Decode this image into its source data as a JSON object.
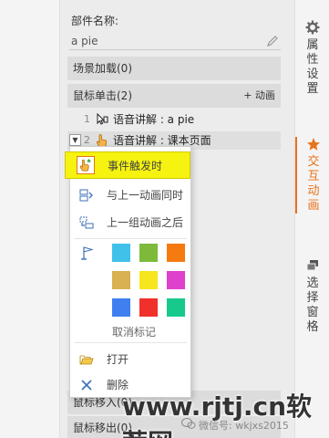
{
  "panel": {
    "name_label": "部件名称:",
    "name_value": "a pie",
    "sections": {
      "load": "场景加载(0)",
      "click": "鼠标单击(2)",
      "add_animation": "+ 动画",
      "hover": "鼠标移入(0)",
      "out": "鼠标移出(0)"
    },
    "rows": [
      {
        "num": "1",
        "text": "语音讲解 : a pie"
      },
      {
        "num": "2",
        "text": "语音讲解 : 课本页面"
      }
    ]
  },
  "right_bar": {
    "items": [
      {
        "label": "属性设置",
        "icon": "gear-icon"
      },
      {
        "label": "交互动画",
        "icon": "star-icon",
        "active": true
      },
      {
        "label": "选择窗格",
        "icon": "layers-icon"
      }
    ]
  },
  "menu": {
    "trigger": "事件触发时",
    "with_previous": "与上一动画同时",
    "after_previous": "上一组动画之后",
    "clear_mark": "取消标记",
    "open": "打开",
    "delete": "删除",
    "colors": [
      "#3fc1ea",
      "#7dba3a",
      "#f57a10",
      "#d9b052",
      "#f7e51e",
      "#df40cc",
      "#3f7ff0",
      "#f0302a",
      "#17c98a"
    ]
  },
  "watermark": {
    "site": "www.rjtj.cn软荐网",
    "wechat": "微信号: wkjxs2015"
  },
  "colors": {
    "accent": "#e8731c",
    "highlight": "#f5f30f"
  }
}
